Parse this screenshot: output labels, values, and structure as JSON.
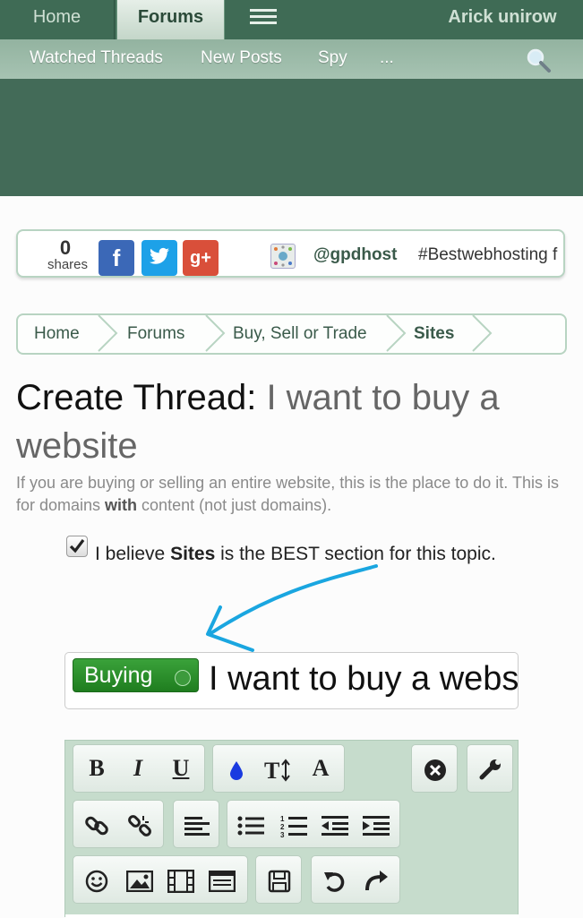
{
  "nav": {
    "tabs": [
      "Home",
      "Forums"
    ],
    "user": "Arick unirow"
  },
  "subnav": {
    "items": [
      "Watched Threads",
      "New Posts",
      "Spy",
      "..."
    ]
  },
  "share": {
    "count": "0",
    "count_label": "shares",
    "handle": "@gpdhost",
    "hashtag": "#Bestwebhosting f",
    "buttons": {
      "facebook": "f",
      "google": "g+"
    }
  },
  "breadcrumb": [
    "Home",
    "Forums",
    "Buy, Sell or Trade",
    "Sites"
  ],
  "page": {
    "title_prefix": "Create Thread:",
    "title_text": "I want to buy a website",
    "desc_part1": "If you are buying or selling an entire website, this is the place to do it. This is for domains ",
    "desc_bold": "with",
    "desc_part2": " content (not just domains)."
  },
  "checkbox": {
    "checked": true,
    "label_pre": "I believe ",
    "label_bold": "Sites",
    "label_post": " is the BEST section for this topic."
  },
  "title_input": {
    "prefix": "Buying",
    "value": "I want to buy a website"
  },
  "editor": {
    "bold": "B",
    "italic": "I",
    "underline": "U",
    "font": "A"
  },
  "colors": {
    "nav_bg": "#3f6b55",
    "accent": "#3a5a4a",
    "prefix_green": "#2a8f2a",
    "annotation_blue": "#1aa6e0"
  }
}
